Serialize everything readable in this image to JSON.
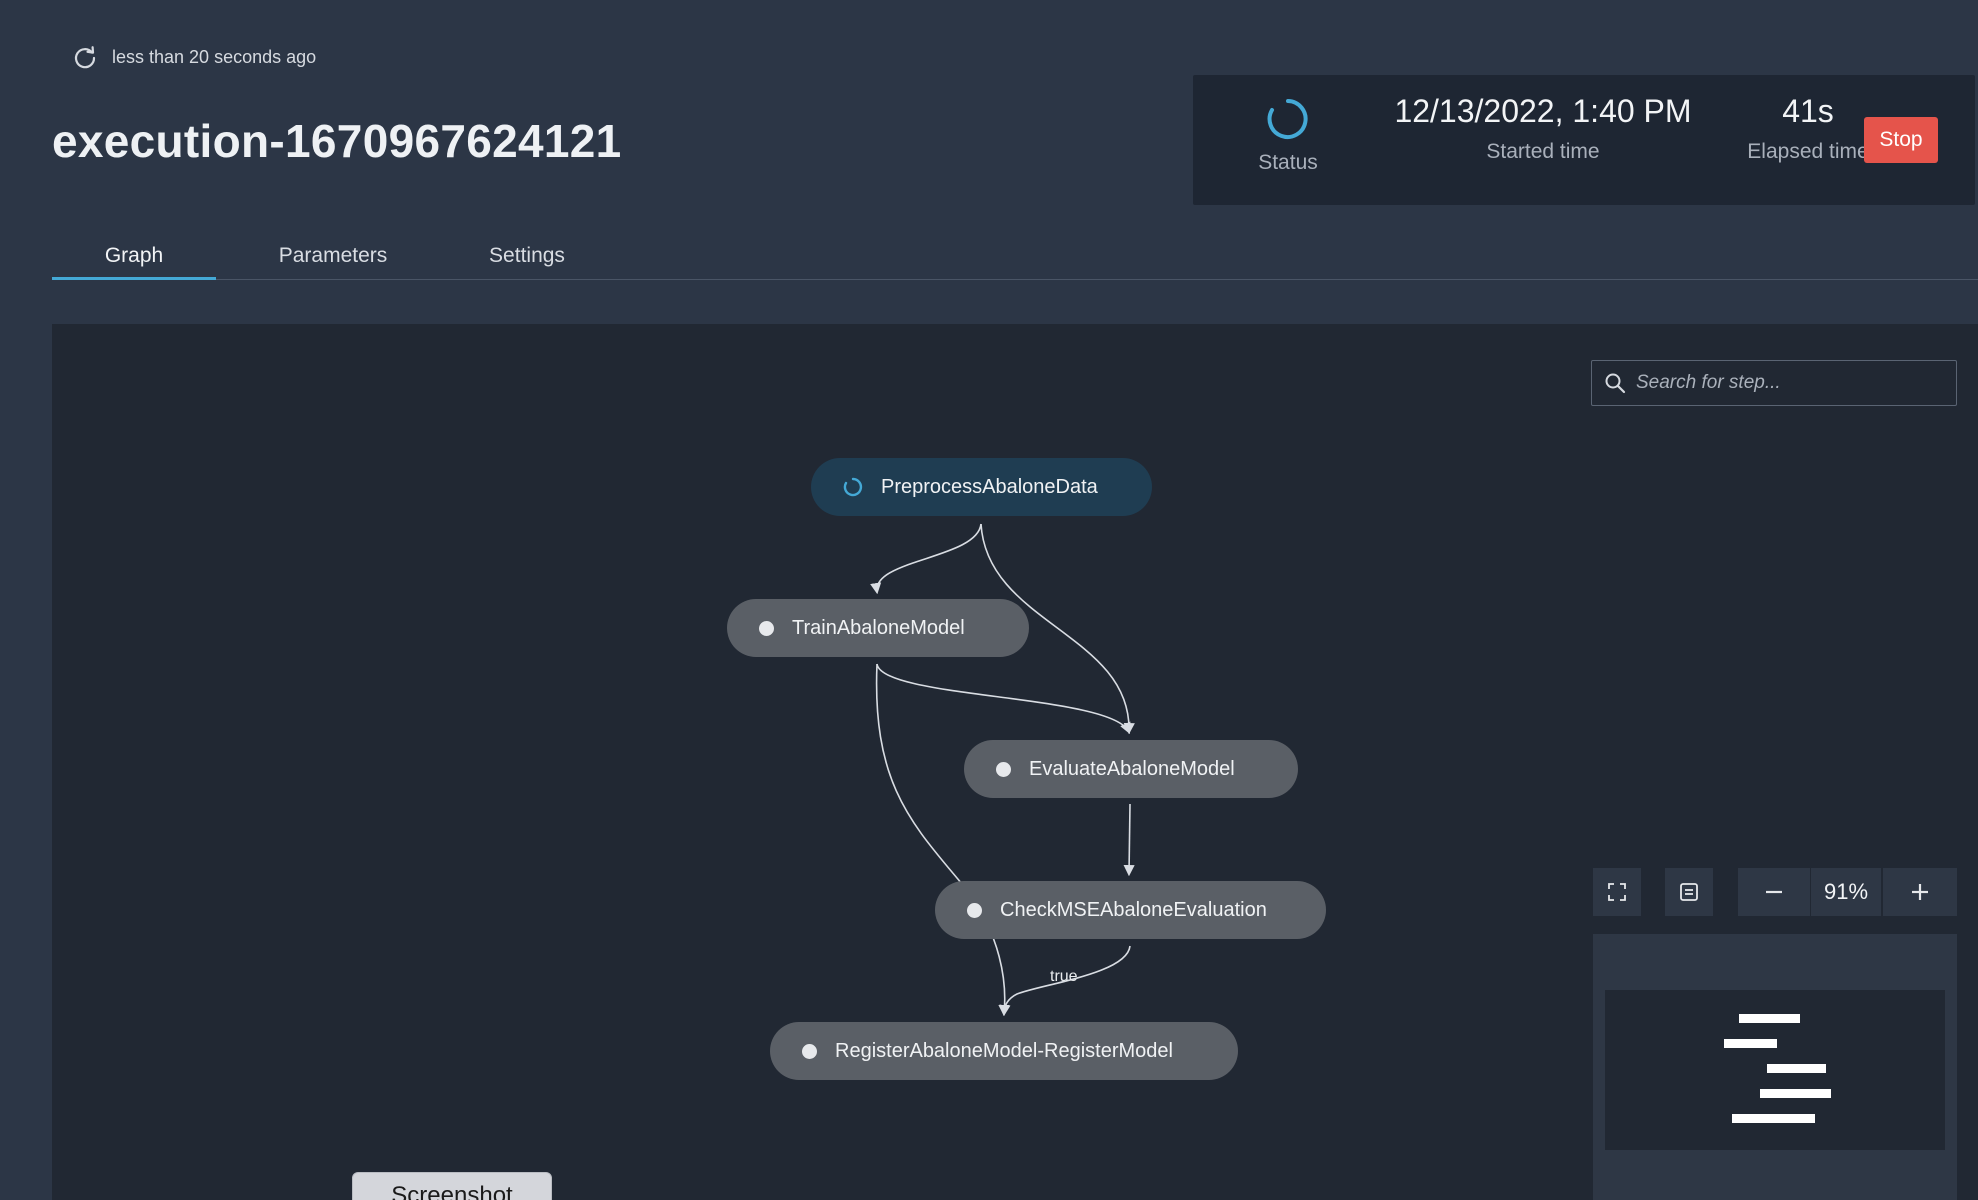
{
  "header": {
    "refresh_text": "less than 20 seconds ago",
    "execution_title": "execution-1670967624121"
  },
  "status_panel": {
    "status_label": "Status",
    "started_time": "12/13/2022, 1:40 PM",
    "started_label": "Started time",
    "elapsed_time": "41s",
    "elapsed_label": "Elapsed time",
    "stop_label": "Stop"
  },
  "tabs": [
    {
      "label": "Graph",
      "active": true
    },
    {
      "label": "Parameters",
      "active": false
    },
    {
      "label": "Settings",
      "active": false
    }
  ],
  "graph": {
    "search_placeholder": "Search for step...",
    "nodes": [
      {
        "label": "PreprocessAbaloneData",
        "state": "running"
      },
      {
        "label": "TrainAbaloneModel",
        "state": "pending"
      },
      {
        "label": "EvaluateAbaloneModel",
        "state": "pending"
      },
      {
        "label": "CheckMSEAbaloneEvaluation",
        "state": "pending"
      },
      {
        "label": "RegisterAbaloneModel-RegisterModel",
        "state": "pending"
      }
    ],
    "edge_label": "true",
    "zoom": "91%"
  },
  "overlay": {
    "screenshot_label": "Screenshot"
  },
  "colors": {
    "page_bg": "#2c3646",
    "canvas_bg": "#212833",
    "accent": "#44a9d6",
    "stop": "#e5544b",
    "node_pending": "#5a5f66",
    "node_running": "#1f3d52"
  }
}
